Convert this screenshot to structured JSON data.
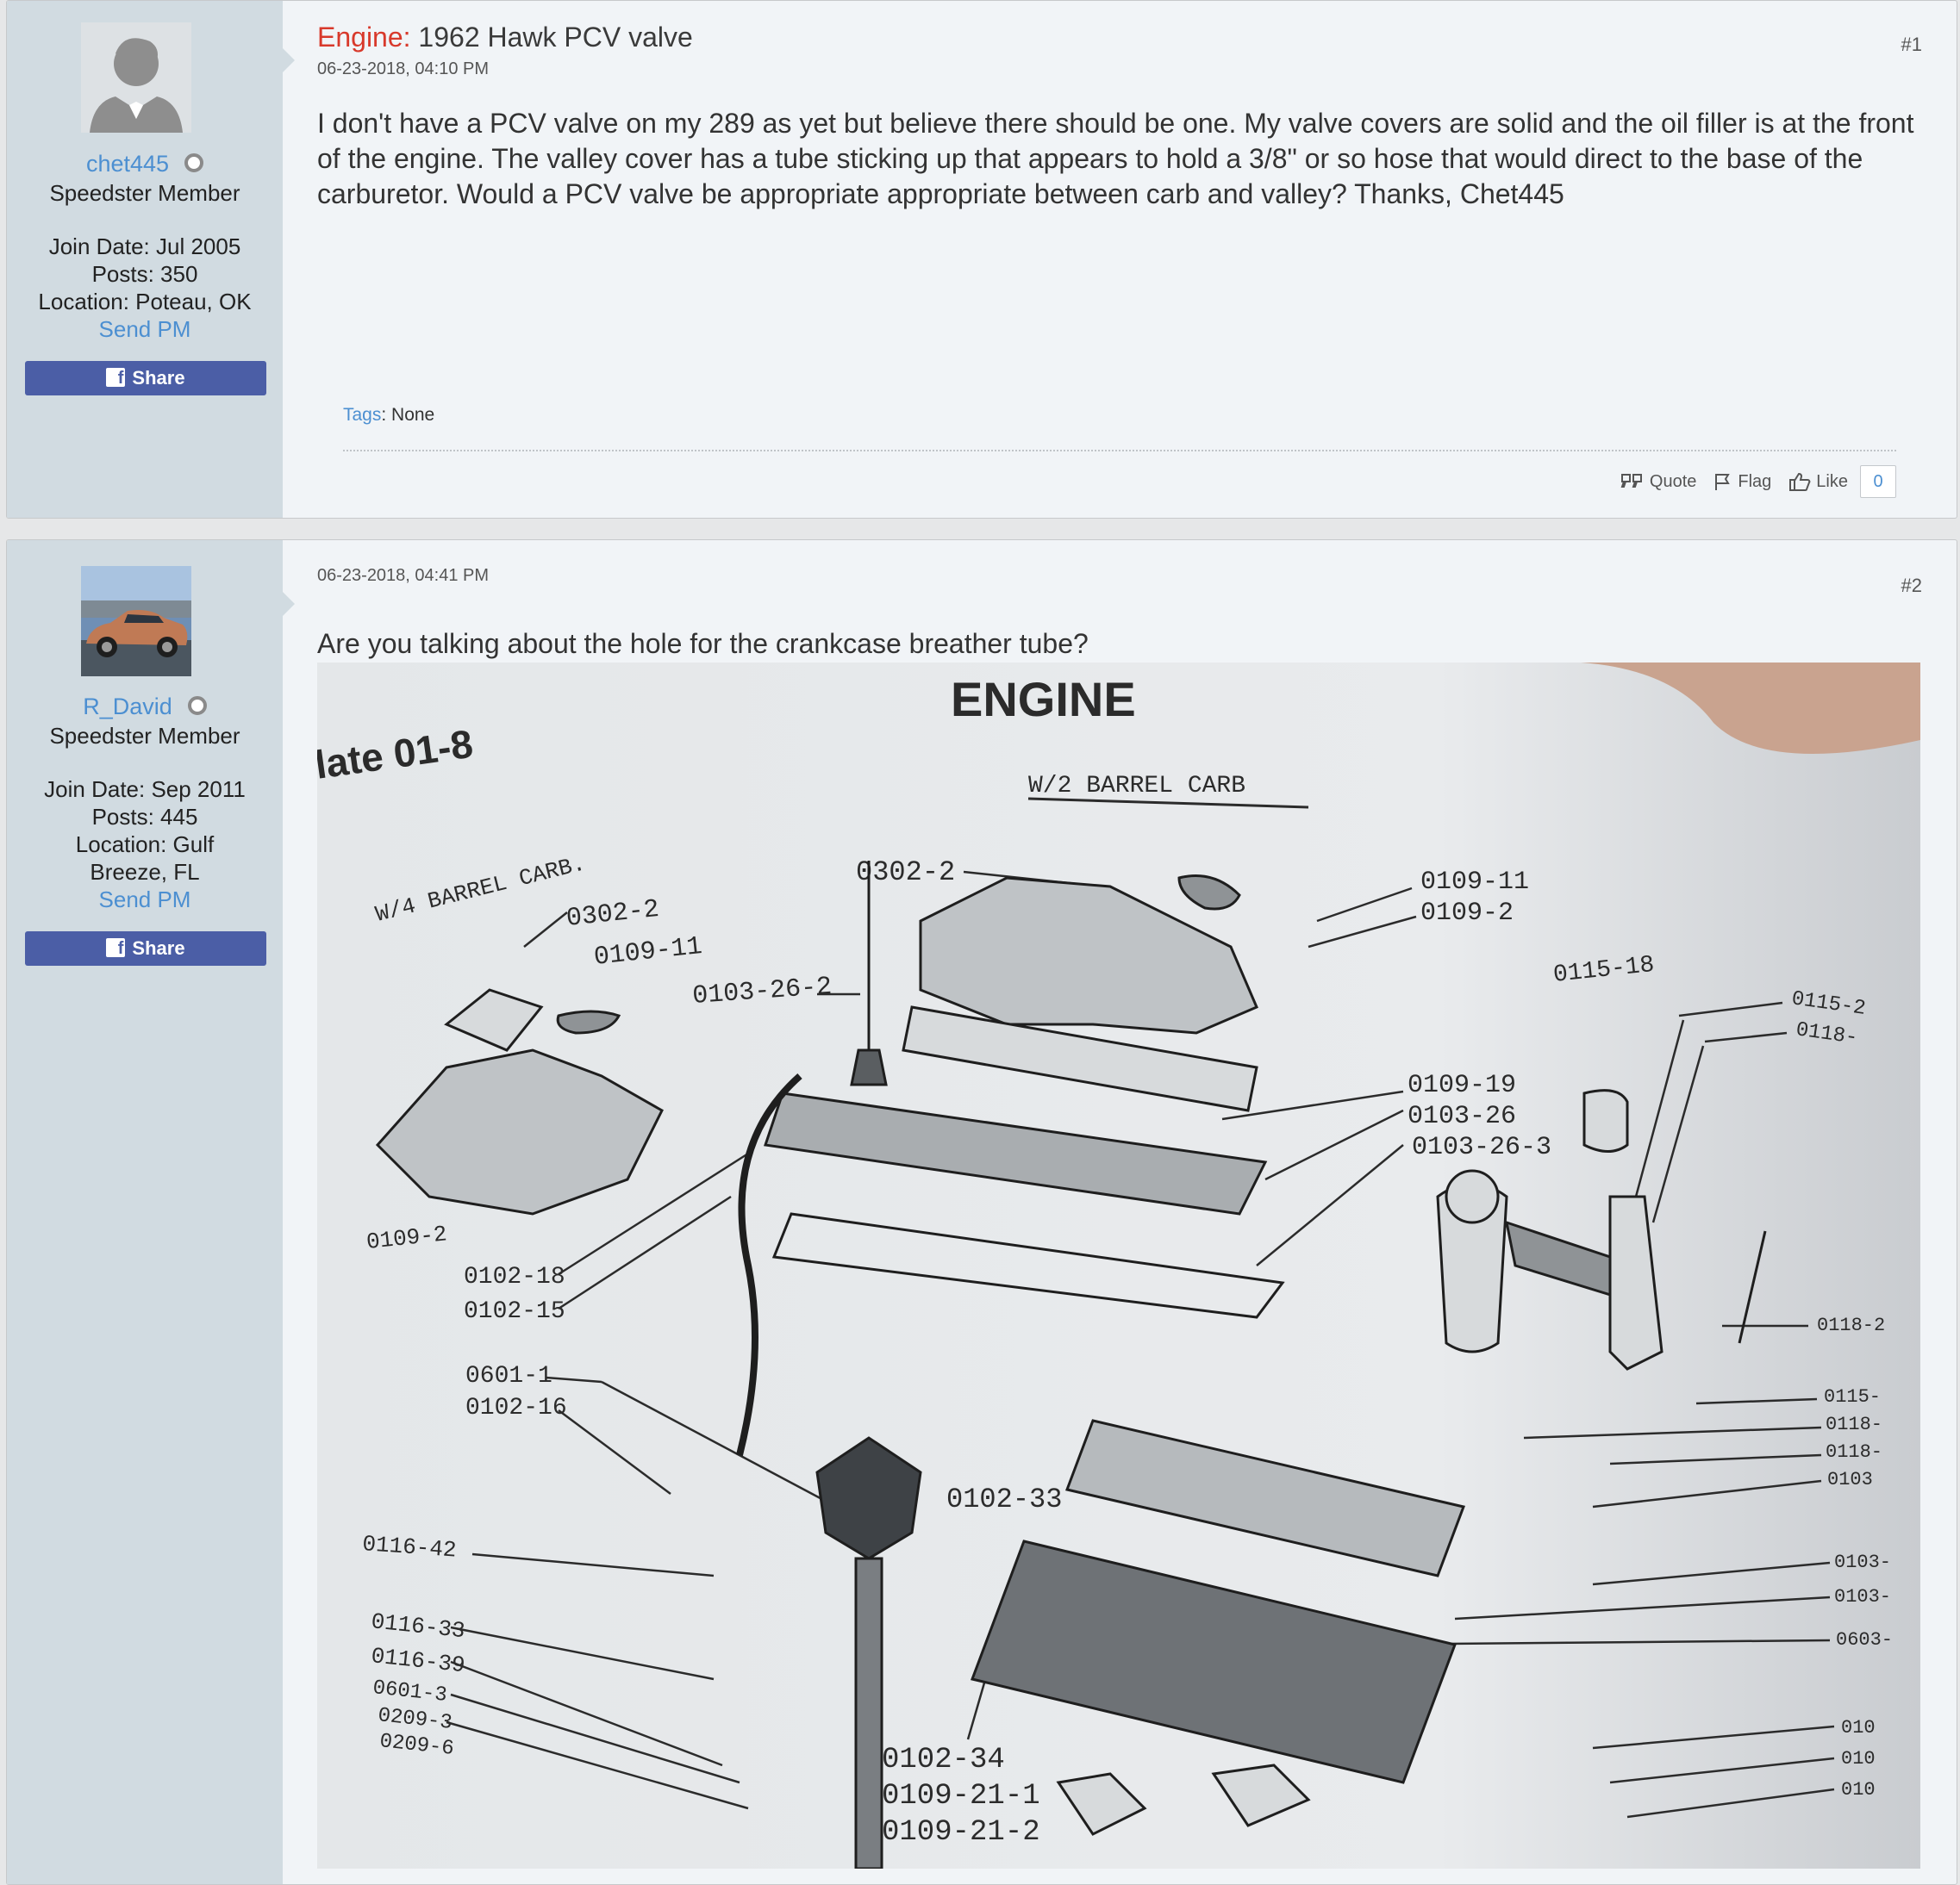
{
  "posts": [
    {
      "user": {
        "name": "chet445",
        "title": "Speedster Member",
        "join_date": "Join Date: Jul 2005",
        "posts": "Posts: 350",
        "location_line1": "Location: Poteau, OK",
        "location_line2": "",
        "send_pm": "Send PM",
        "share": "Share"
      },
      "title_prefix": "Engine:",
      "title": "1962 Hawk PCV valve",
      "date": "06-23-2018, 04:10 PM",
      "number": "#1",
      "message": "I don't have a PCV valve on my 289 as yet but believe there should be one. My valve covers are solid and the oil filler is at the front of the engine. The valley cover has a tube sticking up that appears to hold a 3/8\" or so hose that would direct to the base of the carburetor. Would a PCV valve be appropriate appropriate between carb and valley? Thanks, Chet445",
      "tags_label": "Tags",
      "tags_value": ": None",
      "actions": {
        "quote": "Quote",
        "flag": "Flag",
        "like": "Like",
        "like_count": "0"
      }
    },
    {
      "user": {
        "name": "R_David",
        "title": "Speedster Member",
        "join_date": "Join Date: Sep 2011",
        "posts": "Posts: 445",
        "location_line1": "Location: Gulf",
        "location_line2": "Breeze, FL",
        "send_pm": "Send PM",
        "share": "Share"
      },
      "date": "06-23-2018, 04:41 PM",
      "number": "#2",
      "message": "Are you talking about the hole for the crankcase breather tube?",
      "image": {
        "heading": "ENGINE",
        "plate": "late 01-8",
        "labels": {
          "w2": "W/2 BARREL CARB",
          "w4": "W/4 BARREL CARB.",
          "l1": "0302-2",
          "l2": "0302-2",
          "l3": "0109-11",
          "l4": "0109-11",
          "l5": "0109-2",
          "l6": "0103-26-2",
          "l7": "0115-18",
          "l8": "0115-2",
          "l9": "0118-",
          "l10": "0109-19",
          "l11": "0103-26",
          "l12": "0103-26-3",
          "l13": "0109-2",
          "l14": "0102-18",
          "l15": "0102-15",
          "l16": "0601-1",
          "l17": "0102-16",
          "l18": "0118-2",
          "l19": "0115-",
          "l20": "0118-",
          "l21": "0118-",
          "l22": "0103",
          "l23": "0102-33",
          "l24": "0116-42",
          "l25": "0116-33",
          "l26": "0116-39",
          "l27": "0601-3",
          "l28": "0209-3",
          "l29": "0209-6",
          "l30": "0102-34",
          "l31": "0109-21-1",
          "l32": "0109-21-2",
          "l33": "0103-",
          "l34": "0103-",
          "l35": "0603-",
          "l36": "010",
          "l37": "010",
          "l38": "010"
        }
      }
    }
  ]
}
